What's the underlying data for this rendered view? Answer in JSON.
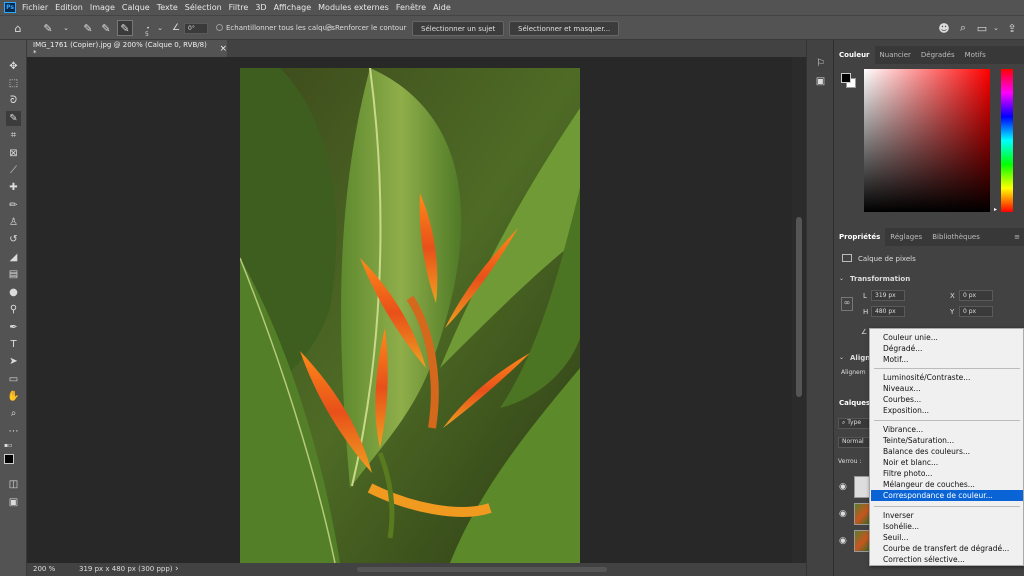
{
  "app": {
    "logo": "Ps"
  },
  "menubar": {
    "items": [
      "Fichier",
      "Edition",
      "Image",
      "Calque",
      "Texte",
      "Sélection",
      "Filtre",
      "3D",
      "Affichage",
      "Modules externes",
      "Fenêtre",
      "Aide"
    ]
  },
  "options": {
    "brush_size": "5",
    "angle": "0°",
    "sample_all_layers": "Echantillonner tous les calques",
    "enhance_edge": "Renforcer le contour",
    "select_subject": "Sélectionner un sujet",
    "select_and_mask": "Sélectionner et masquer..."
  },
  "document": {
    "tab_title": "IMG_1761 (Copier).jpg @ 200% (Calque 0, RVB/8) *",
    "close_glyph": "×"
  },
  "status": {
    "zoom": "200 %",
    "doc_info": "319 px x 480 px (300 ppp)",
    "arrow": "›"
  },
  "panels": {
    "color_tabs": [
      "Couleur",
      "Nuancier",
      "Dégradés",
      "Motifs"
    ],
    "properties_tabs": [
      "Propriétés",
      "Réglages",
      "Bibliothèques"
    ],
    "pixel_layer": "Calque de pixels",
    "transform_title": "Transformation",
    "w_label": "L",
    "w_value": "319 px",
    "h_label": "H",
    "h_value": "480 px",
    "x_label": "X",
    "x_value": "0 px",
    "y_label": "Y",
    "y_value": "0 px",
    "align_title": "Aligne",
    "align_sub": "Alignem",
    "layers_tab": "Calques",
    "layer_filter": "Type",
    "blend_mode": "Normal",
    "lock_label": "Verrou :"
  },
  "context_menu": {
    "items": [
      "Couleur unie...",
      "Dégradé...",
      "Motif...",
      "Luminosité/Contraste...",
      "Niveaux...",
      "Courbes...",
      "Exposition...",
      "Vibrance...",
      "Teinte/Saturation...",
      "Balance des couleurs...",
      "Noir et blanc...",
      "Filtre photo...",
      "Mélangeur de couches...",
      "Correspondance de couleur...",
      "Inverser",
      "Isohélie...",
      "Seuil...",
      "Courbe de transfert de dégradé...",
      "Correction sélective..."
    ],
    "highlighted": "Correspondance de couleur..."
  },
  "colors": {
    "accent": "#0a64d6",
    "foreground_swatch": "#000000",
    "background_swatch": "#ffffff"
  }
}
